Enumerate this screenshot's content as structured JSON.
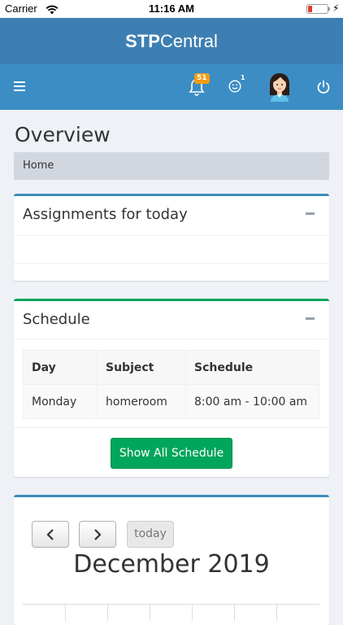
{
  "status_bar": {
    "carrier": "Carrier",
    "time": "11:16 AM"
  },
  "brand": {
    "bold": "STP",
    "light": "Central"
  },
  "nav": {
    "notifications_count": "51",
    "messages_count": "1"
  },
  "page": {
    "title": "Overview",
    "breadcrumb": "Home"
  },
  "assignments": {
    "title": "Assignments for today"
  },
  "schedule": {
    "title": "Schedule",
    "columns": [
      "Day",
      "Subject",
      "Schedule"
    ],
    "rows": [
      [
        "Monday",
        "homeroom",
        "8:00 am - 10:00 am"
      ]
    ],
    "button_label": "Show All Schedule"
  },
  "calendar": {
    "today_label": "today",
    "month_title": "December 2019"
  },
  "colors": {
    "brand_header": "#3d7fb2",
    "nav_bar": "#3c8dc4",
    "primary_box_border": "#3c8dbc",
    "success": "#00a65a",
    "badge": "#f39c12"
  }
}
